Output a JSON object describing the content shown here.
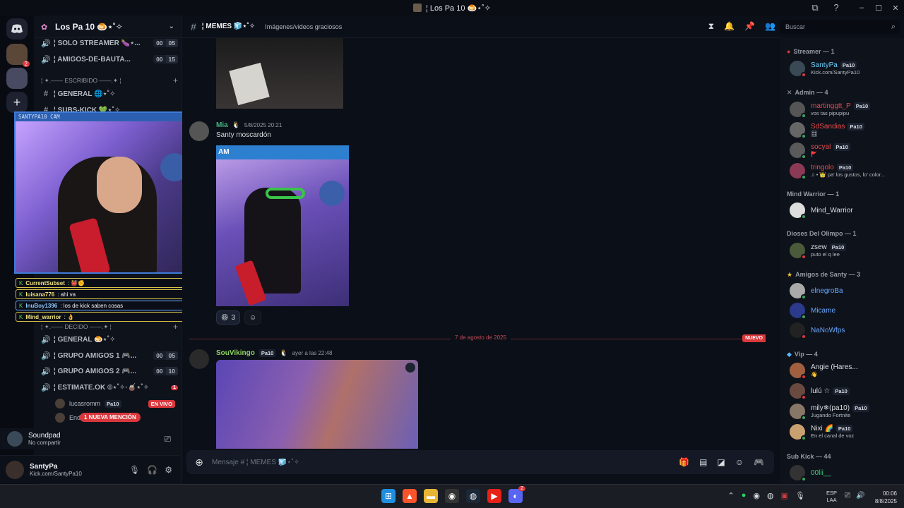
{
  "window": {
    "title": "¦ Los Pa 10 🍮⋆˚✧"
  },
  "server": {
    "name": "Los Pa 10 🍮⋆˚✧"
  },
  "channels": {
    "solo_streamer": {
      "name": "¦ SOLO STREAMER 🍆⋆...",
      "count_a": "00",
      "count_b": "05"
    },
    "amigos_bauta": {
      "name": "¦ AMIGOS-DE-BAUTA...",
      "count_a": "00",
      "count_b": "15"
    },
    "cat_escribido": "¦ ✦.—— ESCRIBIDO ——.✦ ¦",
    "general_top": "¦ GENERAL 🌐⋆˚✧",
    "subs_kick": "¦ SUBS-KICK 💚⋆˚✧",
    "cat_decido": "¦ ✦.—— DECIDO ——.✦ ¦",
    "general_voice": "¦ GENERAL 🍮⋆˚✧",
    "grupo1": {
      "name": "¦ GRUPO AMIGOS 1 🎮...",
      "count_a": "00",
      "count_b": "05"
    },
    "grupo2": {
      "name": "¦ GRUPO AMIGOS 2 🎮...",
      "count_a": "00",
      "count_b": "10"
    },
    "estimate": {
      "name": "¦ ESTIMATE.OK ©⋆˚✧·🧉⋆˚✧",
      "badge": "1"
    },
    "voice_user1": {
      "name": "lucasromm",
      "tag": "Pa10",
      "live": "EN VIVO"
    },
    "voice_user2": {
      "name": "End"
    },
    "mention": "1 NUEVA MENCIÓN"
  },
  "overlay": {
    "cam_title": "SANTYPA10 CAM",
    "chat": [
      {
        "name": "CurrentSubset",
        "msg": ": 👹✊"
      },
      {
        "name": "luisana776",
        "msg": ": ahi va"
      },
      {
        "name": "InuBoy1396",
        "msg": ": los de kick saben cosas"
      },
      {
        "name": "Mind_warrior",
        "msg": ": 👌"
      }
    ]
  },
  "soundpad": {
    "name": "Soundpad",
    "status": "No compartir"
  },
  "user": {
    "name": "SantyPa",
    "status": "Kick.com/SantyPa10"
  },
  "header": {
    "channel": "¦ MEMES 🧊⋆˚✧",
    "topic": "Imágenes/videos graciosos",
    "search_placeholder": "Buscar"
  },
  "messages": {
    "mia": {
      "author": "Mia",
      "author_color": "#43b581",
      "timestamp": "5/8/2025 20:21",
      "text": "Santy moscardón",
      "image_bar": "AM"
    },
    "reaction": {
      "emoji": "😆",
      "count": "3"
    },
    "date_divider": "7 de agosto de 2025",
    "new_label": "NUEVO",
    "souvikingo": {
      "author": "SouVikingo",
      "author_color": "#8fd35f",
      "tag": "Pa10",
      "timestamp": "ayer a las 22:48"
    }
  },
  "composer": {
    "placeholder": "Mensaje # ¦ MEMES 🧊⋆˚✧"
  },
  "members": {
    "streamer": {
      "label": "Streamer — 1"
    },
    "santypa": {
      "name": "SantyPa",
      "tag": "Pa10",
      "sub": "Kick.com/SantyPa10",
      "color": "#6ad1ff"
    },
    "admin": {
      "label": "Admin — 4"
    },
    "martin": {
      "name": "martinggtt_P",
      "tag": "Pa10",
      "sub": "vos tas pipupipu",
      "color": "#e84a4a"
    },
    "sdsandias": {
      "name": "SdSandias",
      "tag": "Pa10",
      "sub": "🎛",
      "color": "#e84a4a"
    },
    "socyal": {
      "name": "socyal",
      "tag": "Pa10",
      "sub": "🚩",
      "color": "#e84a4a"
    },
    "tringolo": {
      "name": "tringolo",
      "tag": "Pa10",
      "sub": "♫ • 👑 pa' los gustos, lo' color...",
      "color": "#e84a4a"
    },
    "mindwarrior_cat": {
      "label": "Mind Warrior — 1"
    },
    "mindwarrior": {
      "name": "Mind_Warrior",
      "color": "#dbdee1"
    },
    "dioses": {
      "label": "Dioses Del Olimpo — 1"
    },
    "zsew": {
      "name": "zsew",
      "tag": "Pa10",
      "sub": "puto el q lee",
      "color": "#dbdee1"
    },
    "amigos_santy": {
      "label": "Amigos de Santy — 3"
    },
    "elnegroba": {
      "name": "elnegroBa",
      "color": "#6aa8ff"
    },
    "micame": {
      "name": "Micame",
      "color": "#6aa8ff"
    },
    "nanowfps": {
      "name": "NaNoWfps",
      "color": "#6aa8ff"
    },
    "vip": {
      "label": "Vip — 4"
    },
    "angie": {
      "name": "Angie (Hares...",
      "sub": "👋",
      "color": "#dbdee1"
    },
    "lulu": {
      "name": "lulú ☆",
      "tag": "Pa10",
      "color": "#dbdee1"
    },
    "mily": {
      "name": "mily❄(pa10)",
      "tag": "Pa10",
      "sub": "Jugando Fortnite",
      "color": "#dbdee1"
    },
    "nixi": {
      "name": "Nixi 🌈",
      "tag": "Pa10",
      "sub": "En el canal de voz",
      "color": "#dbdee1"
    },
    "subkick": {
      "label": "Sub Kick — 44"
    },
    "oolii": {
      "name": "00lii__",
      "color": "#43d17a"
    }
  },
  "taskbar": {
    "lang_1": "ESP",
    "lang_2": "LAA",
    "time": "00:06",
    "date": "8/8/2025",
    "discord_badge": "2"
  },
  "colors": {
    "accent": "#5865f2",
    "danger": "#da373c",
    "bg": "#0b0f17"
  }
}
